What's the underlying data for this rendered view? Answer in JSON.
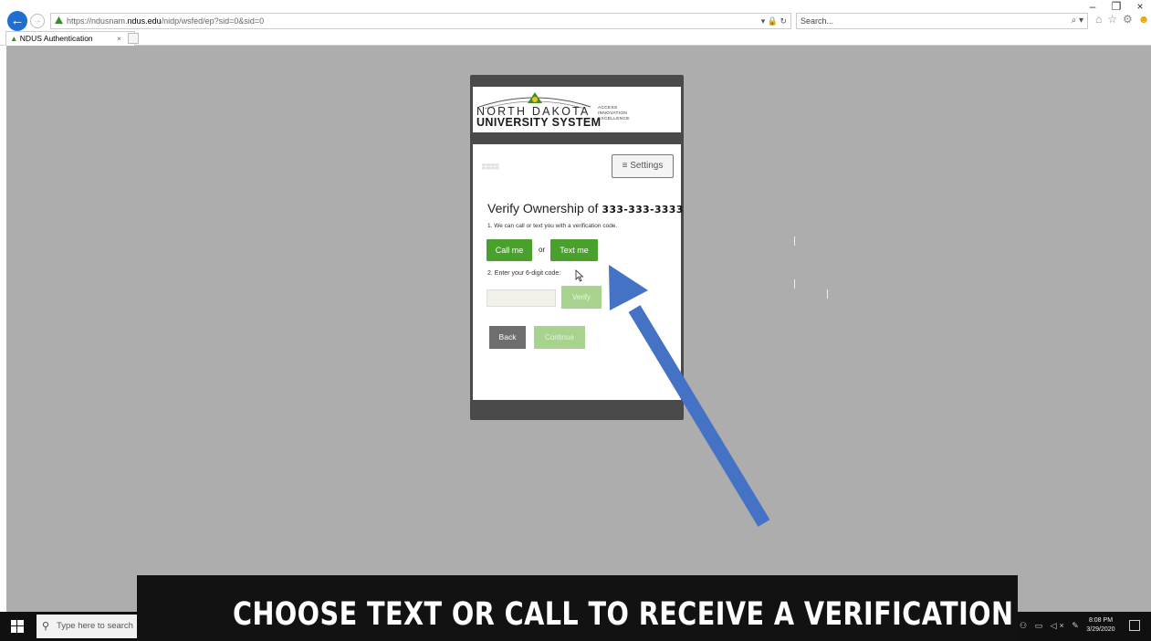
{
  "browser": {
    "url_prefix": "https://ndusnam.",
    "url_host": "ndus.edu",
    "url_path": "/nidp/wsfed/ep?sid=0&sid=0",
    "search_placeholder": "Search...",
    "tab_title": "NDUS Authentication",
    "tab_close": "×",
    "window_controls": [
      "–",
      "❐",
      "×"
    ]
  },
  "brand": {
    "line1": "NORTH DAKOTA",
    "line2": "UNIVERSITY SYSTEM",
    "tagline": [
      "ACCESS",
      "INNOVATION",
      "EXCELLENCE"
    ]
  },
  "app": {
    "settings_label": "≡ Settings",
    "title": "Verify Ownership of",
    "phone_number": "333-333-3333",
    "step1": "1. We can call or text you with a verification code.",
    "call_label": "Call me",
    "or_label": "or",
    "text_label": "Text me",
    "step2": "2. Enter your 6-digit code:",
    "verify_label": "Verify",
    "back_label": "Back",
    "continue_label": "Continue"
  },
  "taskbar": {
    "search_placeholder": "Type here to search",
    "time": "8:08 PM",
    "date": "3/29/2020"
  },
  "caption": "CHOOSE TEXT OR CALL TO RECEIVE A VERIFICATION CODE",
  "colors": {
    "accent_green": "#4aa02c",
    "disabled_green": "#a8d38f",
    "arrow_blue": "#4472c4",
    "page_gray": "#adadad"
  }
}
